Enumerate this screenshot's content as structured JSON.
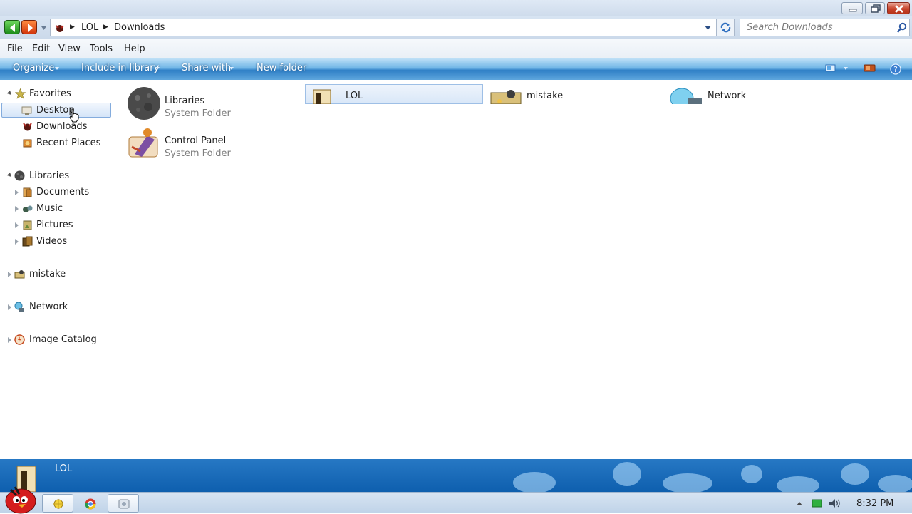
{
  "address": {
    "crumbs": [
      "LOL",
      "Downloads"
    ]
  },
  "search": {
    "placeholder": "Search Downloads"
  },
  "menu": {
    "file": "File",
    "edit": "Edit",
    "view": "View",
    "tools": "Tools",
    "help": "Help"
  },
  "commands": {
    "organize": "Organize",
    "include": "Include in library",
    "share": "Share with",
    "new_folder": "New folder"
  },
  "nav": {
    "favorites": "Favorites",
    "desktop": "Desktop",
    "downloads": "Downloads",
    "recent": "Recent Places",
    "libraries": "Libraries",
    "documents": "Documents",
    "music": "Music",
    "pictures": "Pictures",
    "videos": "Videos",
    "mistake": "mistake",
    "network": "Network",
    "image_catalog": "Image Catalog"
  },
  "items": [
    {
      "name": "Libraries",
      "sub": "System Folder",
      "icon": "libraries-icon"
    },
    {
      "name": "LOL",
      "sub": "",
      "icon": "lol-folder-icon"
    },
    {
      "name": "mistake",
      "sub": "",
      "icon": "mistake-icon"
    },
    {
      "name": "Network",
      "sub": "",
      "icon": "network-icon"
    },
    {
      "name": "Control Panel",
      "sub": "System Folder",
      "icon": "control-panel-icon"
    }
  ],
  "details": {
    "name": "LOL"
  },
  "taskbar": {
    "time": "8:32 PM"
  },
  "colors": {
    "accent": "#2f7fc6",
    "selection": "#d5e5f8"
  }
}
